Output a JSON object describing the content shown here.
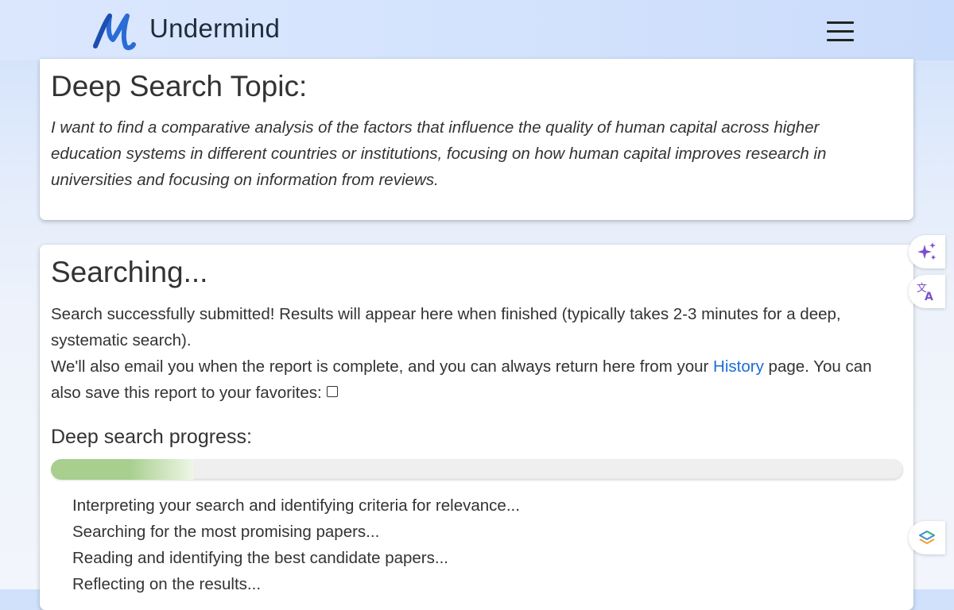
{
  "header": {
    "brand": "Undermind",
    "logo_icon": "undermind-logo",
    "menu_icon": "hamburger-menu-icon"
  },
  "topic_card": {
    "title": "Deep Search Topic:",
    "topic_text": "I want to find a comparative analysis of the factors that influence the quality of human capital across higher education systems in different countries or institutions, focusing on how human capital improves research in universities and focusing on information from reviews."
  },
  "search_card": {
    "title": "Searching...",
    "submitted_text": "Search successfully submitted! Results will appear here when finished (typically takes 2-3 minutes for a deep, systematic search).",
    "email_text_before": "We'll also email you when the report is complete, and you can always return here from your ",
    "history_link": "History",
    "email_text_after": " page. You can also save this report to your favorites:",
    "favorite_checked": false,
    "progress_label": "Deep search progress:",
    "progress_fraction": 0.167,
    "steps": [
      "Interpreting your search and identifying criteria for relevance...",
      "Searching for the most promising papers...",
      "Reading and identifying the best candidate papers...",
      "Reflecting on the results..."
    ]
  },
  "side_buttons": [
    {
      "icon": "sparkles-icon"
    },
    {
      "icon": "translate-icon"
    },
    {
      "icon": "layers-icon"
    }
  ],
  "colors": {
    "accent_link": "#1a6fd4",
    "progress_fill": "#a8cf8e",
    "logo_blue": "#2a6bd6",
    "sparkle_purple": "#7b4fc9"
  }
}
